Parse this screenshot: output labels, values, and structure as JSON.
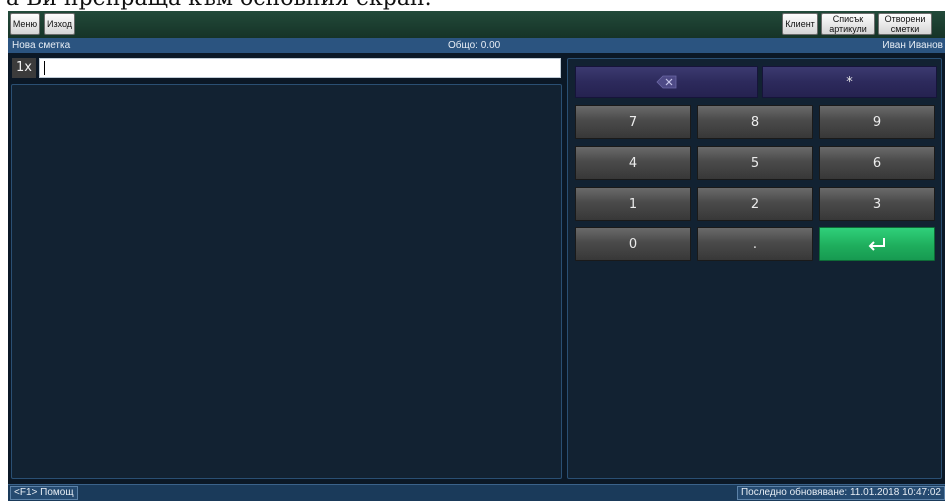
{
  "caption": "а Ви препраща към основния екран.",
  "toolbar": {
    "menu_label": "Меню",
    "exit_label": "Изход",
    "client_label": "Клиент",
    "items_list_label_1": "Списък",
    "items_list_label_2": "артикули",
    "open_bills_label_1": "Отворени",
    "open_bills_label_2": "сметки"
  },
  "status": {
    "bill_name": "Нова сметка",
    "total": "Общо: 0.00",
    "user": "Иван Иванов"
  },
  "entry": {
    "quantity": "1x",
    "value": ""
  },
  "keypad": {
    "backspace_icon": "backspace-icon",
    "multiply": "*",
    "keys": [
      "7",
      "8",
      "9",
      "4",
      "5",
      "6",
      "1",
      "2",
      "3",
      "0",
      "."
    ],
    "enter_icon": "enter-icon",
    "enter_color": "#1fae5d"
  },
  "footer": {
    "help": "<F1> Помощ",
    "last_update": "Последно обновяване: 11.01.2018 10:47:02"
  },
  "colors": {
    "toolbar": "#1d4232",
    "status_bar": "#2b5480",
    "panel": "#122232",
    "key": "#4a4a4a",
    "key_fn": "#2d2a5c"
  }
}
